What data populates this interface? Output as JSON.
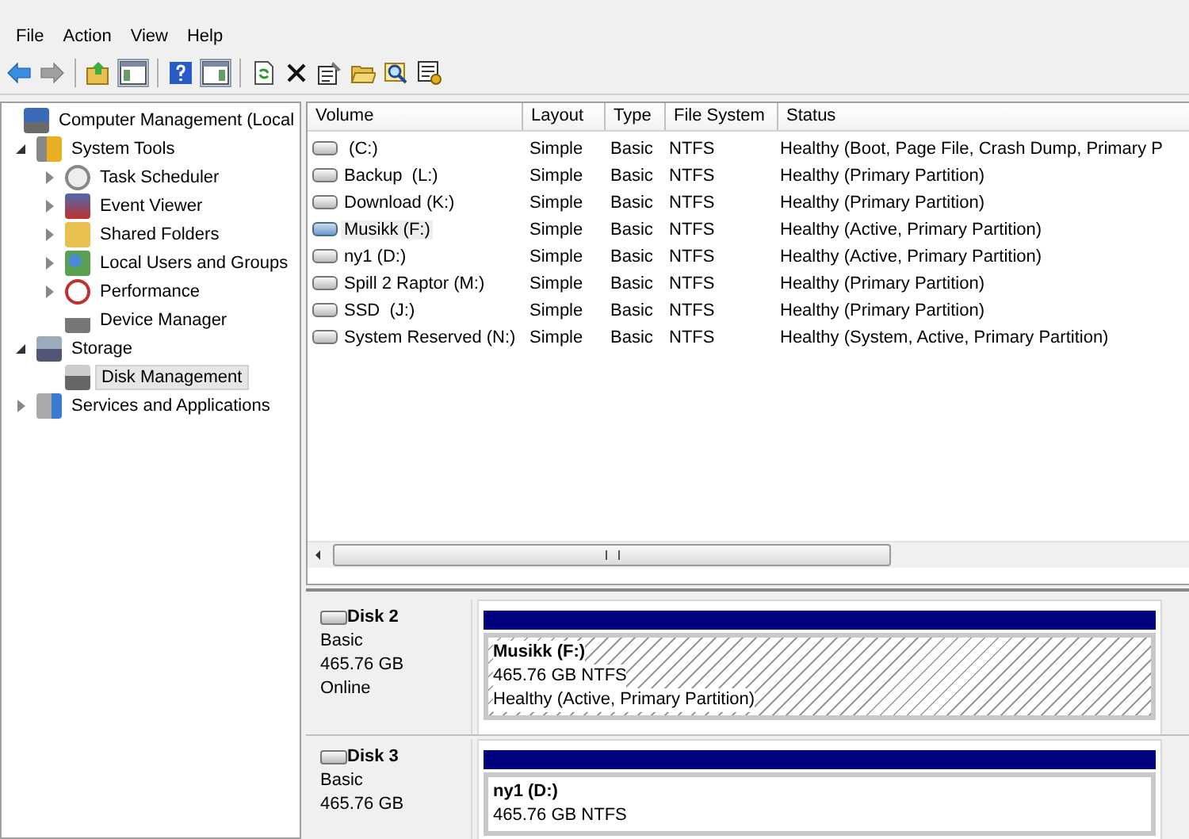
{
  "menu": [
    "File",
    "Action",
    "View",
    "Help"
  ],
  "nav": {
    "back_disabled": false,
    "forward_disabled": true
  },
  "tree": [
    {
      "label": "Computer Management (Local",
      "selected": false,
      "children": [
        {
          "label": "System Tools",
          "expanded": true,
          "selected": false,
          "children": [
            {
              "label": "Task Scheduler",
              "expanded": false,
              "selected": false
            },
            {
              "label": "Event Viewer",
              "expanded": false,
              "selected": false
            },
            {
              "label": "Shared Folders",
              "expanded": false,
              "selected": false
            },
            {
              "label": "Local Users and Groups",
              "expanded": false,
              "selected": false
            },
            {
              "label": "Performance",
              "expanded": false,
              "selected": false
            },
            {
              "label": "Device Manager",
              "selected": false
            }
          ]
        },
        {
          "label": "Storage",
          "expanded": true,
          "selected": false,
          "children": [
            {
              "label": "Disk Management",
              "selected": true
            }
          ]
        },
        {
          "label": "Services and Applications",
          "expanded": false,
          "selected": false
        }
      ]
    }
  ],
  "table": {
    "columns": [
      "Volume",
      "Layout",
      "Type",
      "File System",
      "Status"
    ],
    "rows": [
      {
        "cells": [
          " (C:)",
          "Simple",
          "Basic",
          "NTFS",
          "Healthy (Boot, Page File, Crash Dump, Primary P"
        ],
        "selected": false
      },
      {
        "cells": [
          "Backup  (L:)",
          "Simple",
          "Basic",
          "NTFS",
          "Healthy (Primary Partition)"
        ],
        "selected": false
      },
      {
        "cells": [
          "Download (K:)",
          "Simple",
          "Basic",
          "NTFS",
          "Healthy (Primary Partition)"
        ],
        "selected": false
      },
      {
        "cells": [
          "Musikk (F:)",
          "Simple",
          "Basic",
          "NTFS",
          "Healthy (Active, Primary Partition)"
        ],
        "selected": true
      },
      {
        "cells": [
          "ny1 (D:)",
          "Simple",
          "Basic",
          "NTFS",
          "Healthy (Active, Primary Partition)"
        ],
        "selected": false
      },
      {
        "cells": [
          "Spill 2 Raptor (M:)",
          "Simple",
          "Basic",
          "NTFS",
          "Healthy (Primary Partition)"
        ],
        "selected": false
      },
      {
        "cells": [
          "SSD  (J:)",
          "Simple",
          "Basic",
          "NTFS",
          "Healthy (Primary Partition)"
        ],
        "selected": false
      },
      {
        "cells": [
          "System Reserved (N:)",
          "Simple",
          "Basic",
          "NTFS",
          "Healthy (System, Active, Primary Partition)"
        ],
        "selected": false
      }
    ]
  },
  "disks": [
    {
      "name": "Disk 2",
      "info": [
        "Basic",
        "465.76 GB",
        "Online"
      ],
      "partition": {
        "name": "Musikk  (F:)",
        "lines": [
          "465.76 GB NTFS",
          "Healthy (Active, Primary Partition)"
        ],
        "selected": true
      }
    },
    {
      "name": "Disk 3",
      "info": [
        "Basic",
        "465.76 GB"
      ],
      "partition": {
        "name": "ny1  (D:)",
        "lines": [
          "465.76 GB NTFS"
        ],
        "selected": false
      }
    }
  ]
}
